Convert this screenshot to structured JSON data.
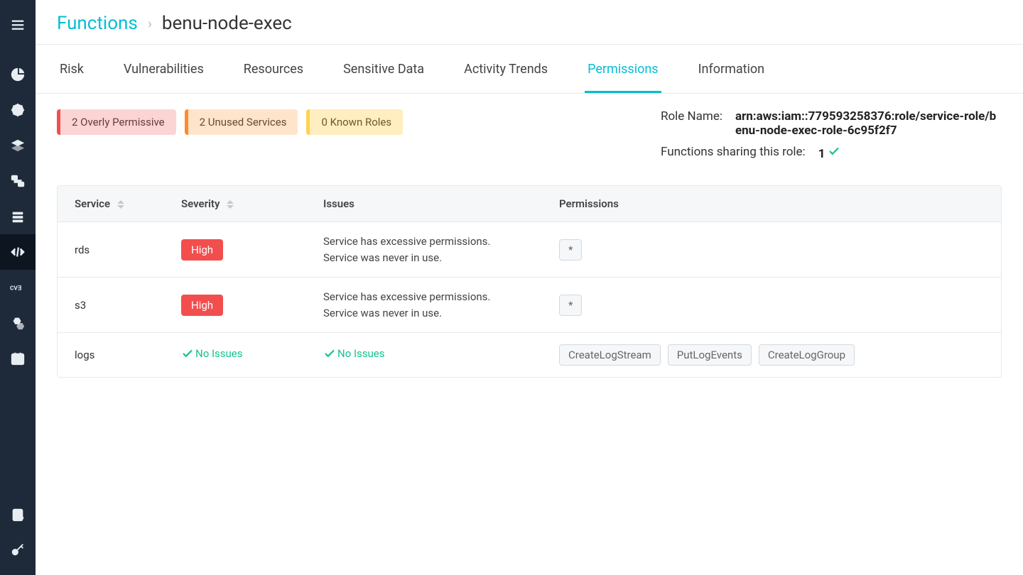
{
  "breadcrumb": {
    "root": "Functions",
    "current": "benu-node-exec"
  },
  "tabs": [
    {
      "label": "Risk",
      "active": false
    },
    {
      "label": "Vulnerabilities",
      "active": false
    },
    {
      "label": "Resources",
      "active": false
    },
    {
      "label": "Sensitive Data",
      "active": false
    },
    {
      "label": "Activity Trends",
      "active": false
    },
    {
      "label": "Permissions",
      "active": true
    },
    {
      "label": "Information",
      "active": false
    }
  ],
  "badges": [
    {
      "text": "2 Overly Permissive",
      "variant": "red"
    },
    {
      "text": "2 Unused Services",
      "variant": "orange"
    },
    {
      "text": "0 Known Roles",
      "variant": "yellow"
    }
  ],
  "role": {
    "name_label": "Role Name:",
    "name_value": "arn:aws:iam::779593258376:role/service-role/benu-node-exec-role-6c95f2f7",
    "sharing_label": "Functions sharing this role:",
    "sharing_value": "1"
  },
  "table": {
    "headers": {
      "service": "Service",
      "severity": "Severity",
      "issues": "Issues",
      "permissions": "Permissions"
    },
    "rows": [
      {
        "service": "rds",
        "severity": "High",
        "severity_type": "pill",
        "issues_type": "text",
        "issues_line1": "Service has excessive permissions.",
        "issues_line2": "Service was never in use.",
        "permissions": [
          "*"
        ]
      },
      {
        "service": "s3",
        "severity": "High",
        "severity_type": "pill",
        "issues_type": "text",
        "issues_line1": "Service has excessive permissions.",
        "issues_line2": "Service was never in use.",
        "permissions": [
          "*"
        ]
      },
      {
        "service": "logs",
        "severity": "No Issues",
        "severity_type": "ok",
        "issues_type": "ok",
        "issues_ok": "No Issues",
        "permissions": [
          "CreateLogStream",
          "PutLogEvents",
          "CreateLogGroup"
        ]
      }
    ]
  },
  "sidebar_icons": [
    "menu-icon",
    "pie-chart-icon",
    "wheel-icon",
    "layers-icon",
    "network-icon",
    "database-icon",
    "code-icon",
    "cv3-icon",
    "hex-icon",
    "calendar-icon"
  ],
  "sidebar_bottom_icons": [
    "clipboard-icon",
    "key-icon"
  ]
}
